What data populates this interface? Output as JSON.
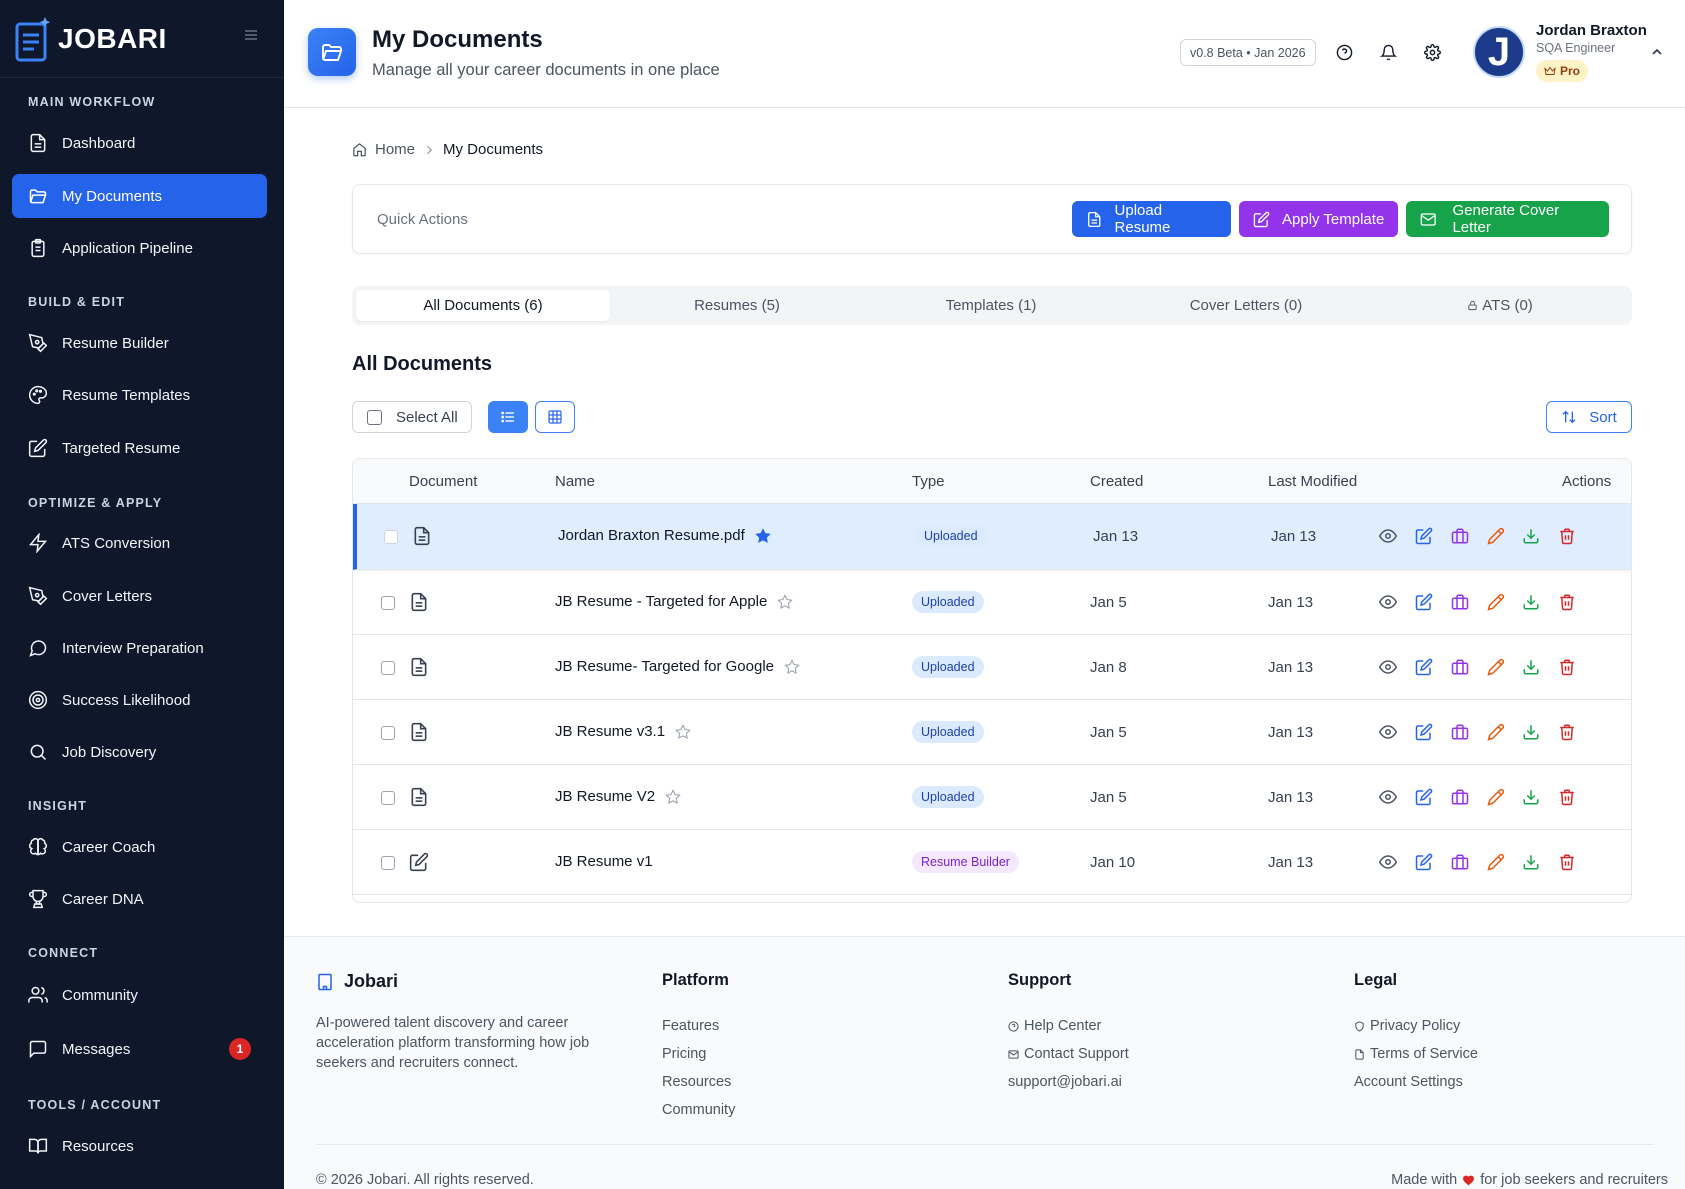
{
  "brand": {
    "name": "JOBARI"
  },
  "sidebar": {
    "sections": [
      "MAIN WORKFLOW",
      "BUILD & EDIT",
      "OPTIMIZE & APPLY",
      "INSIGHT",
      "CONNECT",
      "TOOLS / ACCOUNT"
    ],
    "items": [
      {
        "label": "Dashboard",
        "icon": "file-text-icon"
      },
      {
        "label": "My Documents",
        "icon": "folder-open-icon",
        "active": true
      },
      {
        "label": "Application Pipeline",
        "icon": "clipboard-list-icon"
      },
      {
        "label": "Resume Builder",
        "icon": "pen-tool-icon"
      },
      {
        "label": "Resume Templates",
        "icon": "palette-icon"
      },
      {
        "label": "Targeted Resume",
        "icon": "edit-square-icon"
      },
      {
        "label": "ATS Conversion",
        "icon": "zap-icon"
      },
      {
        "label": "Cover Letters",
        "icon": "pen-tool-icon"
      },
      {
        "label": "Interview Preparation",
        "icon": "message-circle-icon"
      },
      {
        "label": "Success Likelihood",
        "icon": "target-icon"
      },
      {
        "label": "Job Discovery",
        "icon": "search-icon"
      },
      {
        "label": "Career Coach",
        "icon": "brain-icon"
      },
      {
        "label": "Career DNA",
        "icon": "trophy-icon"
      },
      {
        "label": "Community",
        "icon": "users-icon"
      },
      {
        "label": "Messages",
        "icon": "message-square-icon",
        "badge": "1"
      },
      {
        "label": "Resources",
        "icon": "book-open-icon"
      }
    ]
  },
  "header": {
    "title": "My Documents",
    "subtitle": "Manage all your career documents in one place",
    "version": "v0.8 Beta • Jan 2026",
    "user": {
      "name": "Jordan Braxton",
      "role": "SQA Engineer",
      "plan": "Pro",
      "initial": "J"
    }
  },
  "breadcrumb": {
    "home": "Home",
    "current": "My Documents"
  },
  "quick_actions": {
    "label": "Quick Actions",
    "upload": "Upload Resume",
    "template": "Apply Template",
    "cover": "Generate Cover Letter"
  },
  "tabs": [
    {
      "label": "All Documents (6)",
      "active": true
    },
    {
      "label": "Resumes (5)"
    },
    {
      "label": "Templates (1)"
    },
    {
      "label": "Cover Letters (0)"
    },
    {
      "label": "ATS (0)"
    }
  ],
  "section_title": "All Documents",
  "toolbar": {
    "select_all": "Select All",
    "sort": "Sort"
  },
  "table": {
    "headers": [
      "Document",
      "Name",
      "Type",
      "Created",
      "Last Modified",
      "Actions"
    ],
    "rows": [
      {
        "name": "Jordan Braxton Resume.pdf",
        "starred": true,
        "type": "Uploaded",
        "created": "Jan 13",
        "modified": "Jan 13",
        "icon": "file-text-icon"
      },
      {
        "name": "JB Resume - Targeted for Apple",
        "starred": false,
        "type": "Uploaded",
        "created": "Jan 5",
        "modified": "Jan 13",
        "icon": "file-text-icon"
      },
      {
        "name": "JB Resume- Targeted for Google",
        "starred": false,
        "type": "Uploaded",
        "created": "Jan 8",
        "modified": "Jan 13",
        "icon": "file-text-icon"
      },
      {
        "name": "JB Resume v3.1",
        "starred": false,
        "type": "Uploaded",
        "created": "Jan 5",
        "modified": "Jan 13",
        "icon": "file-text-icon"
      },
      {
        "name": "JB Resume V2",
        "starred": false,
        "type": "Uploaded",
        "created": "Jan 5",
        "modified": "Jan 13",
        "icon": "file-text-icon"
      },
      {
        "name": "JB Resume v1",
        "starred": null,
        "type": "Resume Builder",
        "created": "Jan 10",
        "modified": "Jan 13",
        "icon": "edit-square-icon"
      }
    ]
  },
  "footer": {
    "brand": "Jobari",
    "description": "AI-powered talent discovery and career acceleration platform transforming how job seekers and recruiters connect.",
    "platform": {
      "title": "Platform",
      "links": [
        "Features",
        "Pricing",
        "Resources",
        "Community"
      ]
    },
    "support": {
      "title": "Support",
      "links": [
        "Help Center",
        "Contact Support",
        "support@jobari.ai"
      ]
    },
    "legal": {
      "title": "Legal",
      "links": [
        "Privacy Policy",
        "Terms of Service",
        "Account Settings"
      ]
    },
    "copyright": "© 2026 Jobari. All rights reserved.",
    "made_with_prefix": "Made with",
    "made_with_suffix": "for job seekers and recruiters"
  },
  "colors": {
    "sidebar_bg": "#0f172a",
    "primary": "#2563eb",
    "purple": "#9333ea",
    "green": "#16a34a",
    "danger": "#dc2626"
  }
}
